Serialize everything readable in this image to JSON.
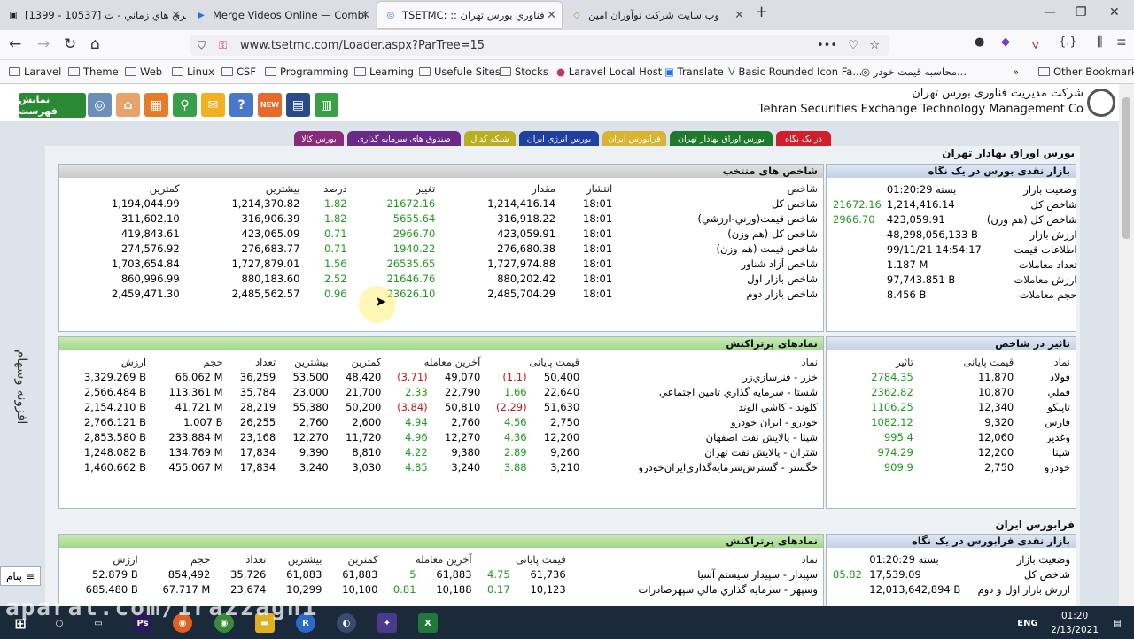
{
  "tabs": [
    {
      "label": "[1399 - 10537] سري هاي زماني - ت",
      "active": false
    },
    {
      "label": "Merge Videos Online — Combi",
      "active": false
    },
    {
      "label": "TSETMC: :: فناوري بورس تهران",
      "active": true
    },
    {
      "label": "وب سایت شرکت نوآوران امین",
      "active": false
    }
  ],
  "url": "www.tsetmc.com/Loader.aspx?ParTree=15",
  "bookmarks": [
    "Laravel",
    "Theme",
    "Web",
    "Linux",
    "CSF",
    "Programming",
    "Learning",
    "Usefule Sites",
    "Stocks",
    "Laravel Local Host",
    "Translate",
    "Basic Rounded Icon Fa...",
    "محاسبه قیمت خودر...",
    "Other Bookmarks"
  ],
  "header": {
    "show_menu": "نمایش فهرست",
    "company_fa": "شرکت مدیریت فناوری بورس تهران",
    "company_en": "Tehran Securities Exchange Technology Management Co"
  },
  "market_tabs": [
    "در یک نگاه",
    "بورس اوراق بهادار تهران",
    "فرابورس ایران",
    "بورس انرژي ایران",
    "شبکه کدال",
    "صندوق های سرمایه گذاری",
    "بورس کالا"
  ],
  "section1": "بورس اوراق بهادار تهران",
  "section2": "فرابورس ایران",
  "glance": {
    "title": "بازار نقدی بورس در یک نگاه",
    "rows": [
      {
        "label": "وضعیت بازار",
        "value": "بسته 01:20:29",
        "extra": ""
      },
      {
        "label": "شاخص کل",
        "value": "1,214,416.14",
        "extra": "21672.16"
      },
      {
        "label": "شاخص کل (هم وزن)",
        "value": "423,059.91",
        "extra": "2966.70"
      },
      {
        "label": "ارزش بازار",
        "value": "48,298,056,133 B",
        "extra": ""
      },
      {
        "label": "اطلاعات قیمت",
        "value": "99/11/21 14:54:17",
        "extra": ""
      },
      {
        "label": "تعداد معاملات",
        "value": "1.187 M",
        "extra": ""
      },
      {
        "label": "ارزش معاملات",
        "value": "97,743.851 B",
        "extra": ""
      },
      {
        "label": "حجم معاملات",
        "value": "8.456 B",
        "extra": ""
      }
    ]
  },
  "indices": {
    "title": "شاخص های منتخب",
    "headers": [
      "شاخص",
      "انتشار",
      "مقدار",
      "تغییر",
      "درصد",
      "بیشترین",
      "کمترین"
    ],
    "rows": [
      [
        "شاخص کل",
        "18:01",
        "1,214,416.14",
        "21672.16",
        "1.82",
        "1,214,370.82",
        "1,194,044.99"
      ],
      [
        "شاخص قیمت(وزني-ارزشي)",
        "18:01",
        "316,918.22",
        "5655.64",
        "1.82",
        "316,906.39",
        "311,602.10"
      ],
      [
        "شاخص کل (هم وزن)",
        "18:01",
        "423,059.91",
        "2966.70",
        "0.71",
        "423,065.09",
        "419,843.61"
      ],
      [
        "شاخص قیمت (هم وزن)",
        "18:01",
        "276,680.38",
        "1940.22",
        "0.71",
        "276,683.77",
        "274,576.92"
      ],
      [
        "شاخص آزاد شناور",
        "18:01",
        "1,727,974.88",
        "26535.65",
        "1.56",
        "1,727,879.01",
        "1,703,654.84"
      ],
      [
        "شاخص بازار اول",
        "18:01",
        "880,202.42",
        "21646.76",
        "2.52",
        "880,183.60",
        "860,996.99"
      ],
      [
        "شاخص بازار دوم",
        "18:01",
        "2,485,704.29",
        "23626.10",
        "0.96",
        "2,485,562.57",
        "2,459,471.30"
      ]
    ]
  },
  "impact": {
    "title": "تاثیر در شاخص",
    "headers": [
      "نماد",
      "قیمت پایانی",
      "تاثیر"
    ],
    "rows": [
      [
        "فولاد",
        "11,870",
        "2784.35"
      ],
      [
        "فملي",
        "10,870",
        "2362.82"
      ],
      [
        "تاپيكو",
        "12,340",
        "1106.25"
      ],
      [
        "فارس",
        "9,320",
        "1082.12"
      ],
      [
        "وغدير",
        "12,060",
        "995.4"
      ],
      [
        "شپنا",
        "12,200",
        "974.29"
      ],
      [
        "خودرو",
        "2,750",
        "909.9"
      ]
    ]
  },
  "active1": {
    "title": "نمادهای پرتراکنش",
    "headers": [
      "نماد",
      "قیمت پایانی",
      "آخرین معامله",
      "کمترین",
      "بیشترین",
      "تعداد",
      "حجم",
      "ارزش"
    ],
    "rows": [
      [
        "خزر - فنرسازي‌زر",
        "50,400",
        "(1.1)",
        "49,070",
        "(3.71)",
        "48,420",
        "53,500",
        "36,259",
        "66.062 M",
        "3,329.269 B"
      ],
      [
        "شستا - سرمايه گذاري تامين اجتماعي",
        "22,640",
        "1.66",
        "22,790",
        "2.33",
        "21,700",
        "23,000",
        "35,784",
        "113.361 M",
        "2,566.484 B"
      ],
      [
        "کلوند - كاشي الوند",
        "51,630",
        "(2.29)",
        "50,810",
        "(3.84)",
        "50,200",
        "55,380",
        "28,219",
        "41.721 M",
        "2,154.210 B"
      ],
      [
        "خودرو - ايران‌ خودرو",
        "2,750",
        "4.56",
        "2,760",
        "4.94",
        "2,600",
        "2,760",
        "26,255",
        "1.007 B",
        "2,766.121 B"
      ],
      [
        "شپنا - پالايش نفت اصفهان",
        "12,200",
        "4.36",
        "12,270",
        "4.96",
        "11,720",
        "12,270",
        "23,168",
        "233.884 M",
        "2,853.580 B"
      ],
      [
        "شتران - پالايش نفت تهران",
        "9,260",
        "2.89",
        "9,380",
        "4.22",
        "8,810",
        "9,390",
        "17,834",
        "134.769 M",
        "1,248.082 B"
      ],
      [
        "خگستر - گسترش‌سرمايه‌گذاري‌ايران‌خودرو",
        "3,210",
        "3.88",
        "3,240",
        "4.85",
        "3,030",
        "3,240",
        "17,834",
        "455.067 M",
        "1,460.662 B"
      ]
    ]
  },
  "glance2": {
    "title": "بازار نقدی فرابورس در یک نگاه",
    "rows": [
      {
        "label": "وضعیت بازار",
        "value": "بسته 01:20:29",
        "extra": ""
      },
      {
        "label": "شاخص کل",
        "value": "17,539.09",
        "extra": "85.82"
      },
      {
        "label": "ارزش بازار اول و دوم",
        "value": "12,013,642,894 B",
        "extra": ""
      }
    ]
  },
  "active2": {
    "title": "نمادهای پرتراکنش",
    "headers": [
      "نماد",
      "قیمت پایانی",
      "آخرین معامله",
      "کمترین",
      "بیشترین",
      "تعداد",
      "حجم",
      "ارزش"
    ],
    "rows": [
      [
        "سپیدار - سپيدار سيستم آسيا",
        "61,736",
        "4.75",
        "61,883",
        "5",
        "61,883",
        "61,883",
        "35,726",
        "854,492",
        "52.879 B"
      ],
      [
        "وسپهر - سرمايه گذاري مالي سپهرصادرات",
        "10,123",
        "0.17",
        "10,188",
        "0.81",
        "10,100",
        "10,299",
        "23,674",
        "67.717 M",
        "685.480 B"
      ]
    ]
  },
  "side_label": "افزونه وسهام",
  "msg_label": "پیام",
  "watermark": "aparat.com/1razzaghi",
  "taskbar": {
    "lang": "ENG",
    "time": "01:20",
    "date": "2/13/2021"
  }
}
